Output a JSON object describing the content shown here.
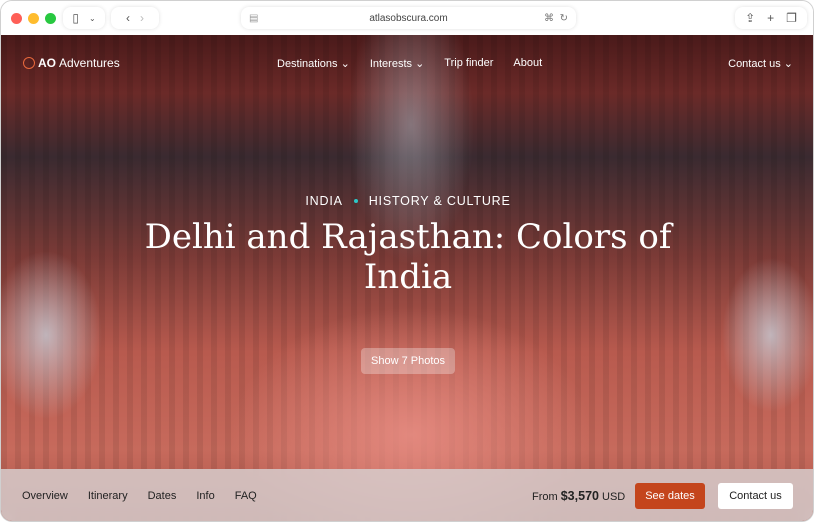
{
  "browser": {
    "url": "atlasobscura.com",
    "traffic_lights": [
      "#fe5f57",
      "#febc2e",
      "#28c840"
    ]
  },
  "nav": {
    "logo_bold": "AO",
    "logo_text": "Adventures",
    "links": [
      "Destinations",
      "Interests",
      "Trip finder",
      "About"
    ],
    "contact": "Contact us"
  },
  "hero": {
    "country": "INDIA",
    "category": "HISTORY & CULTURE",
    "title": "Delhi and Rajasthan: Colors of India",
    "photos_button": "Show 7 Photos"
  },
  "bottom_bar": {
    "tabs": [
      "Overview",
      "Itinerary",
      "Dates",
      "Info",
      "FAQ"
    ],
    "price_prefix": "From",
    "price": "$3,570",
    "currency": "USD",
    "see_dates": "See dates",
    "contact": "Contact us"
  },
  "colors": {
    "accent": "#c4451c",
    "dot": "#2cc7c7"
  }
}
